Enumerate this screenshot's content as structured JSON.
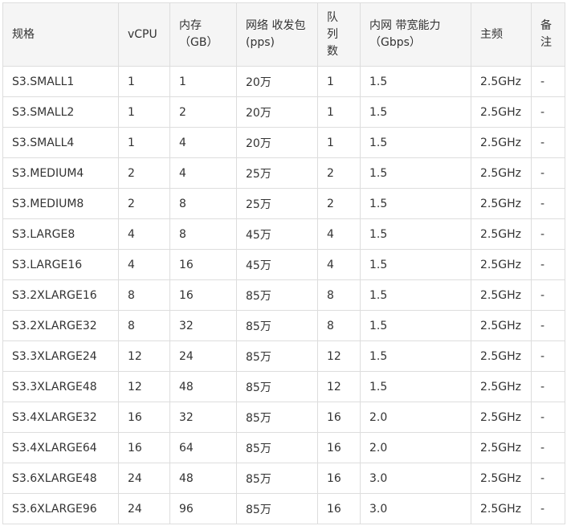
{
  "table": {
    "headers": [
      [
        "规格"
      ],
      [
        "vCPU"
      ],
      [
        "内存",
        "（GB）"
      ],
      [
        "网络 收发包",
        "(pps)"
      ],
      [
        "队",
        "列",
        "数"
      ],
      [
        "内网 带宽能力",
        "（Gbps）"
      ],
      [
        "主频"
      ],
      [
        "备",
        "注"
      ]
    ],
    "rows": [
      [
        "S3.SMALL1",
        "1",
        "1",
        "20万",
        "1",
        "1.5",
        "2.5GHz",
        "-"
      ],
      [
        "S3.SMALL2",
        "1",
        "2",
        "20万",
        "1",
        "1.5",
        "2.5GHz",
        "-"
      ],
      [
        "S3.SMALL4",
        "1",
        "4",
        "20万",
        "1",
        "1.5",
        "2.5GHz",
        "-"
      ],
      [
        "S3.MEDIUM4",
        "2",
        "4",
        "25万",
        "2",
        "1.5",
        "2.5GHz",
        "-"
      ],
      [
        "S3.MEDIUM8",
        "2",
        "8",
        "25万",
        "2",
        "1.5",
        "2.5GHz",
        "-"
      ],
      [
        "S3.LARGE8",
        "4",
        "8",
        "45万",
        "4",
        "1.5",
        "2.5GHz",
        "-"
      ],
      [
        "S3.LARGE16",
        "4",
        "16",
        "45万",
        "4",
        "1.5",
        "2.5GHz",
        "-"
      ],
      [
        "S3.2XLARGE16",
        "8",
        "16",
        "85万",
        "8",
        "1.5",
        "2.5GHz",
        "-"
      ],
      [
        "S3.2XLARGE32",
        "8",
        "32",
        "85万",
        "8",
        "1.5",
        "2.5GHz",
        "-"
      ],
      [
        "S3.3XLARGE24",
        "12",
        "24",
        "85万",
        "12",
        "1.5",
        "2.5GHz",
        "-"
      ],
      [
        "S3.3XLARGE48",
        "12",
        "48",
        "85万",
        "12",
        "1.5",
        "2.5GHz",
        "-"
      ],
      [
        "S3.4XLARGE32",
        "16",
        "32",
        "85万",
        "16",
        "2.0",
        "2.5GHz",
        "-"
      ],
      [
        "S3.4XLARGE64",
        "16",
        "64",
        "85万",
        "16",
        "2.0",
        "2.5GHz",
        "-"
      ],
      [
        "S3.6XLARGE48",
        "24",
        "48",
        "85万",
        "16",
        "3.0",
        "2.5GHz",
        "-"
      ],
      [
        "S3.6XLARGE96",
        "24",
        "96",
        "85万",
        "16",
        "3.0",
        "2.5GHz",
        "-"
      ]
    ]
  }
}
